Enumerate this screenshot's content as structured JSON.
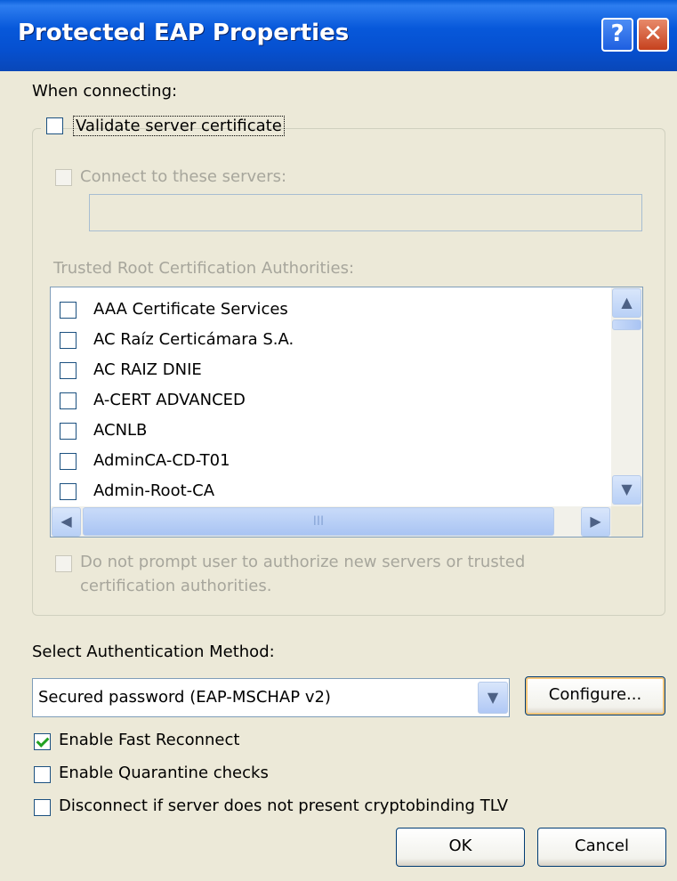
{
  "window": {
    "title": "Protected EAP Properties",
    "help_glyph": "?",
    "close_glyph": "✕"
  },
  "when_connecting_label": "When connecting:",
  "validate": {
    "label": "Validate server certificate",
    "checked": false
  },
  "connect_servers": {
    "label": "Connect to these servers:",
    "value": ""
  },
  "trusted_label": "Trusted Root Certification Authorities:",
  "cert_list": [
    {
      "name": "AAA Certificate Services",
      "checked": false
    },
    {
      "name": "AC Raíz Certicámara S.A.",
      "checked": false
    },
    {
      "name": "AC RAIZ DNIE",
      "checked": false
    },
    {
      "name": "A-CERT ADVANCED",
      "checked": false
    },
    {
      "name": "ACNLB",
      "checked": false
    },
    {
      "name": "AdminCA-CD-T01",
      "checked": false
    },
    {
      "name": "Admin-Root-CA",
      "checked": false
    }
  ],
  "do_not_prompt": {
    "line1": "Do not prompt user to authorize new servers or trusted",
    "line2": "certification authorities."
  },
  "auth_method_label": "Select Authentication Method:",
  "auth_method": {
    "selected": "Secured password (EAP-MSCHAP v2)"
  },
  "configure_label": "Configure...",
  "options": [
    {
      "label": "Enable Fast Reconnect",
      "checked": true
    },
    {
      "label": "Enable Quarantine checks",
      "checked": false
    },
    {
      "label": "Disconnect if server does not present cryptobinding TLV",
      "checked": false
    }
  ],
  "ok_label": "OK",
  "cancel_label": "Cancel",
  "icons": {
    "scroll_up": "▲",
    "scroll_down": "▼",
    "scroll_left": "◀",
    "scroll_right": "▶",
    "dropdown": "▼",
    "grip": "III"
  },
  "colors": {
    "titlebar": "#0650D0",
    "dialog_bg": "#ECE9D8",
    "disabled_text": "#A7A69C",
    "check_mark": "#21A121"
  }
}
